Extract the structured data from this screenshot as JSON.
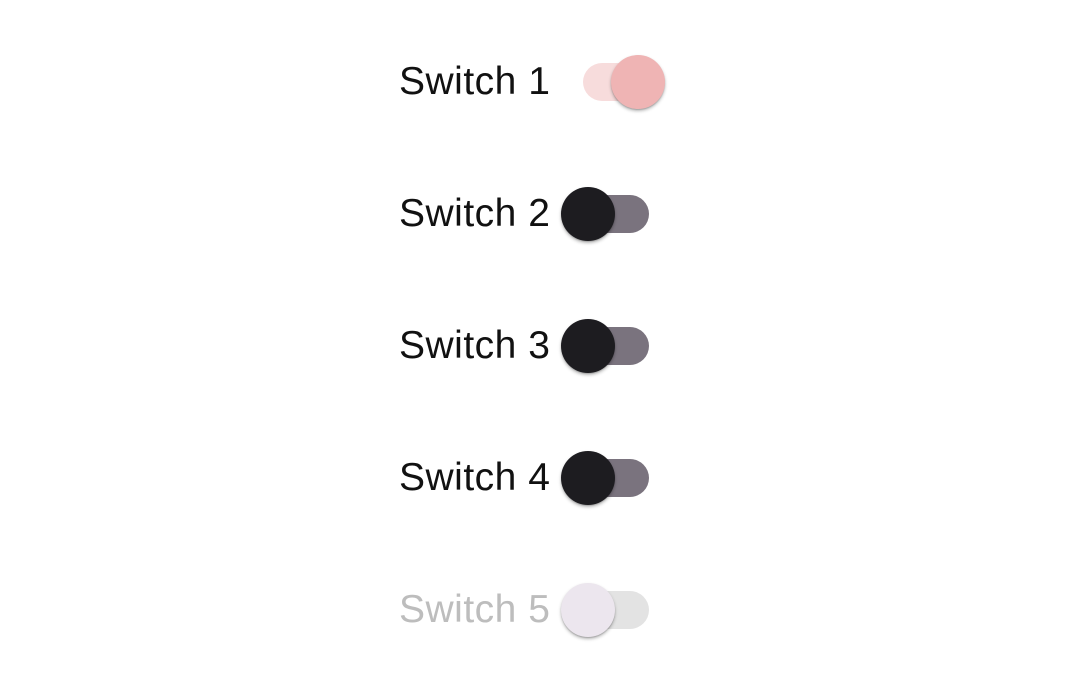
{
  "colors": {
    "label": "#111111",
    "label_disabled": "#bdbdbd",
    "on_track": "#f7dcdc",
    "on_thumb": "#efb4b4",
    "off_track": "#7a737e",
    "off_thumb": "#1d1c20",
    "disabled_track": "#e3e3e3",
    "disabled_thumb": "#ece6ee"
  },
  "switches": [
    {
      "label": "Switch 1",
      "checked": true,
      "enabled": true
    },
    {
      "label": "Switch 2",
      "checked": false,
      "enabled": true
    },
    {
      "label": "Switch 3",
      "checked": false,
      "enabled": true
    },
    {
      "label": "Switch 4",
      "checked": false,
      "enabled": true
    },
    {
      "label": "Switch 5",
      "checked": false,
      "enabled": false
    }
  ]
}
